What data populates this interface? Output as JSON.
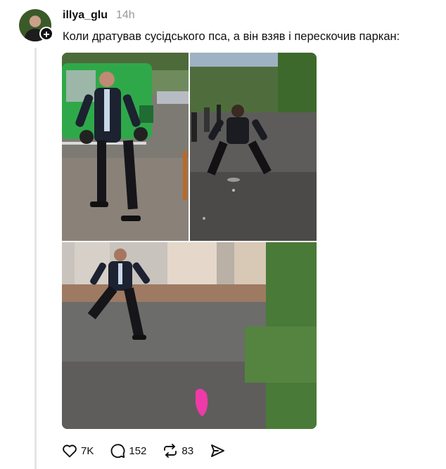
{
  "post": {
    "username": "illya_glu",
    "time": "14h",
    "text": "Коли дратував сусідського пса, а він взяв і перескочив паркан:"
  },
  "avatar": {
    "follow_symbol": "+"
  },
  "media": [
    {
      "id": "video-still-1",
      "description_color": "#5b7a4a"
    },
    {
      "id": "video-still-2",
      "description_color": "#6a6a6a"
    },
    {
      "id": "video-still-3",
      "description_color": "#8a8a88"
    }
  ],
  "actions": {
    "likes": "7K",
    "comments": "152",
    "reposts": "83"
  },
  "icons": [
    "heart-icon",
    "comment-icon",
    "repost-icon",
    "share-icon"
  ]
}
